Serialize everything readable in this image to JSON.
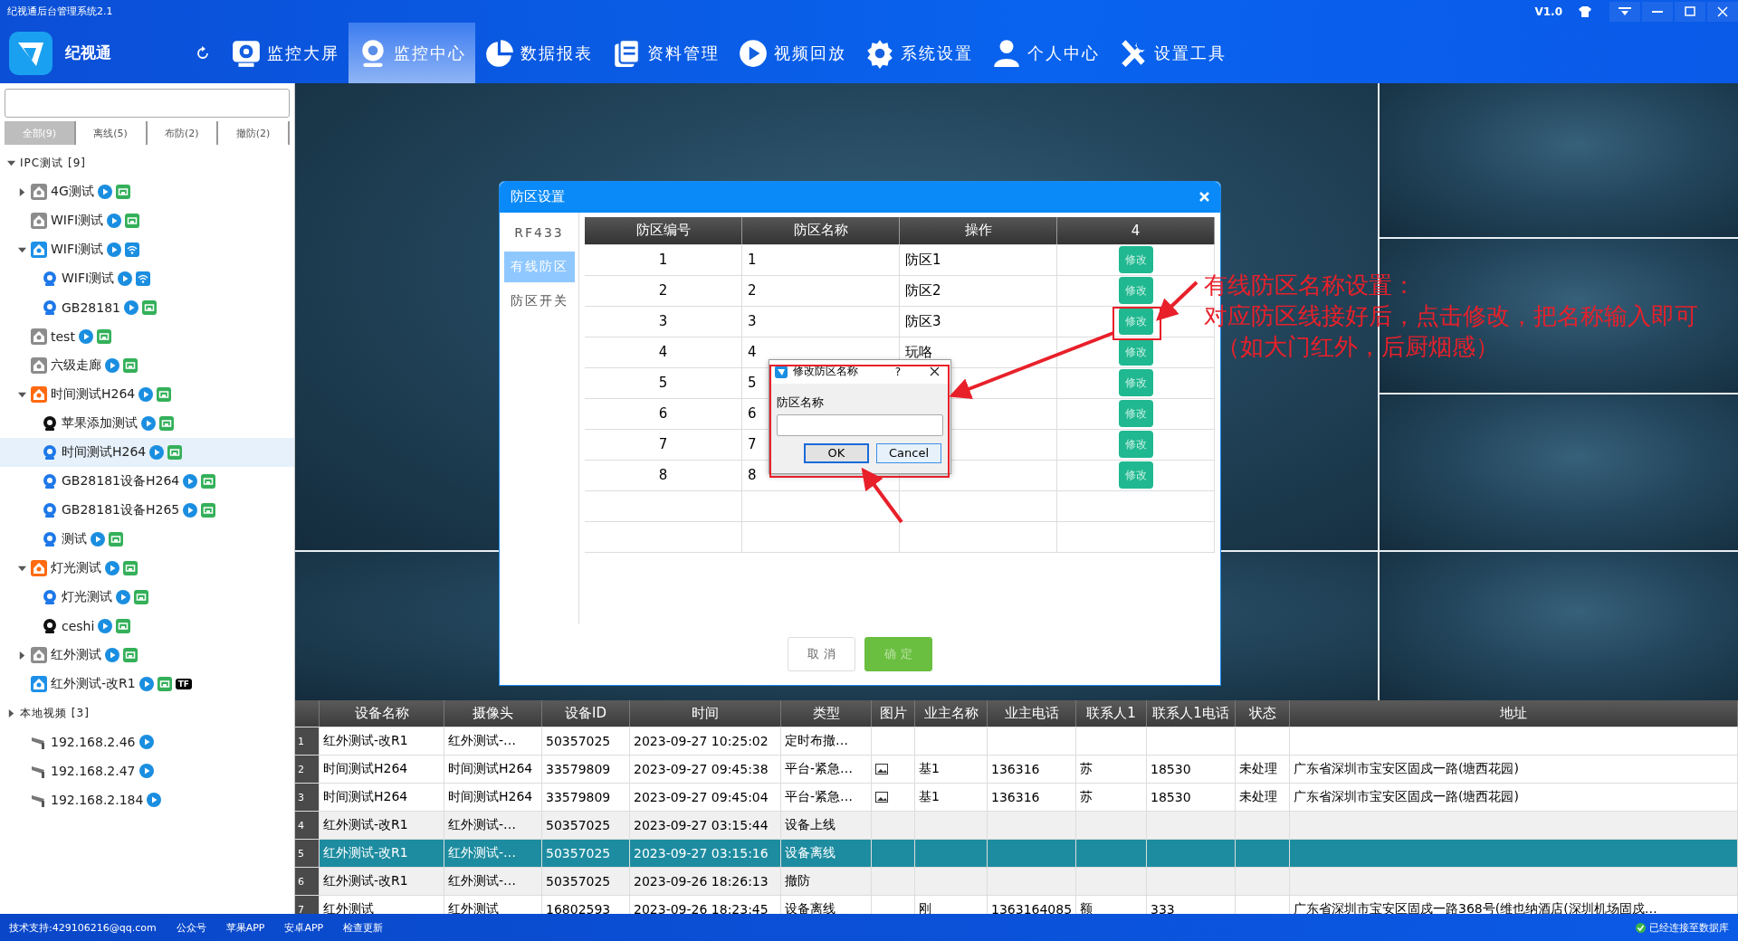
{
  "window": {
    "title": "纪视通后台管理系统2.1",
    "version": "V1.0"
  },
  "header": {
    "logo_text": "纪视通",
    "nav": [
      {
        "label": "监控大屏",
        "selected": false
      },
      {
        "label": "监控中心",
        "selected": true
      },
      {
        "label": "数据报表",
        "selected": false
      },
      {
        "label": "资料管理",
        "selected": false
      },
      {
        "label": "视频回放",
        "selected": false
      },
      {
        "label": "系统设置",
        "selected": false
      },
      {
        "label": "个人中心",
        "selected": false
      },
      {
        "label": "设置工具",
        "selected": false
      }
    ]
  },
  "sidebar": {
    "filters": [
      {
        "label": "全部(9)",
        "selected": true
      },
      {
        "label": "离线(5)",
        "selected": false
      },
      {
        "label": "布防(2)",
        "selected": false
      },
      {
        "label": "撤防(2)",
        "selected": false
      }
    ],
    "tree": [
      {
        "label": "IPC测试 [9]",
        "kind": "folder",
        "expanded": true,
        "selected": false,
        "children": [
          {
            "label": "4G测试",
            "kind": "group",
            "color": "#8c8c8c",
            "expanded": false,
            "selected": false,
            "badges": [
              {
                "kind": "play"
              },
              {
                "kind": "wired"
              }
            ]
          },
          {
            "label": "WIFI测试",
            "kind": "group",
            "color": "#8c8c8c",
            "selected": false,
            "badges": [
              {
                "kind": "play"
              },
              {
                "kind": "wired"
              }
            ]
          },
          {
            "label": "WIFI测试",
            "kind": "group",
            "color": "#1e90e8",
            "expanded": true,
            "selected": false,
            "badges": [
              {
                "kind": "play"
              },
              {
                "kind": "wifi"
              }
            ],
            "children": [
              {
                "label": "WIFI测试",
                "kind": "camera",
                "color": "#1e78e8",
                "selected": false,
                "badges": [
                  {
                    "kind": "play"
                  },
                  {
                    "kind": "wifi"
                  }
                ]
              },
              {
                "label": "GB28181",
                "kind": "camera",
                "color": "#1e78e8",
                "selected": false,
                "badges": [
                  {
                    "kind": "play"
                  },
                  {
                    "kind": "wired"
                  }
                ]
              }
            ]
          },
          {
            "label": "test",
            "kind": "group",
            "color": "#8c8c8c",
            "selected": false,
            "badges": [
              {
                "kind": "play"
              },
              {
                "kind": "wired"
              }
            ]
          },
          {
            "label": "六级走廊",
            "kind": "group",
            "color": "#8c8c8c",
            "selected": false,
            "badges": [
              {
                "kind": "play"
              },
              {
                "kind": "wired"
              }
            ]
          },
          {
            "label": "时间测试H264",
            "kind": "group",
            "color": "#ff6a10",
            "expanded": true,
            "selected": false,
            "badges": [
              {
                "kind": "play"
              },
              {
                "kind": "wired"
              }
            ],
            "children": [
              {
                "label": "苹果添加测试",
                "kind": "camera",
                "color": "#111111",
                "selected": false,
                "badges": [
                  {
                    "kind": "play"
                  },
                  {
                    "kind": "wired"
                  }
                ]
              },
              {
                "label": "时间测试H264",
                "kind": "camera",
                "color": "#1e78e8",
                "selected": true,
                "badges": [
                  {
                    "kind": "play"
                  },
                  {
                    "kind": "wired"
                  }
                ]
              },
              {
                "label": "GB28181设备H264",
                "kind": "camera",
                "color": "#1e78e8",
                "selected": false,
                "badges": [
                  {
                    "kind": "play"
                  },
                  {
                    "kind": "wired"
                  }
                ]
              },
              {
                "label": "GB28181设备H265",
                "kind": "camera",
                "color": "#1e78e8",
                "selected": false,
                "badges": [
                  {
                    "kind": "play"
                  },
                  {
                    "kind": "wired"
                  }
                ]
              },
              {
                "label": "测试",
                "kind": "camera",
                "color": "#1e78e8",
                "selected": false,
                "badges": [
                  {
                    "kind": "play"
                  },
                  {
                    "kind": "wired"
                  }
                ]
              }
            ]
          },
          {
            "label": "灯光测试",
            "kind": "group",
            "color": "#ff6a10",
            "expanded": true,
            "selected": false,
            "badges": [
              {
                "kind": "play"
              },
              {
                "kind": "wired"
              }
            ],
            "children": [
              {
                "label": "灯光测试",
                "kind": "camera",
                "color": "#1e78e8",
                "selected": false,
                "badges": [
                  {
                    "kind": "play"
                  },
                  {
                    "kind": "wired"
                  }
                ]
              },
              {
                "label": "ceshi",
                "kind": "camera",
                "color": "#111111",
                "selected": false,
                "badges": [
                  {
                    "kind": "play"
                  },
                  {
                    "kind": "wired"
                  }
                ]
              }
            ]
          },
          {
            "label": "红外测试",
            "kind": "group",
            "color": "#8c8c8c",
            "expanded": false,
            "selected": false,
            "badges": [
              {
                "kind": "play"
              },
              {
                "kind": "wired"
              }
            ]
          },
          {
            "label": "红外测试-改R1",
            "kind": "group",
            "color": "#1e90e8",
            "selected": false,
            "badges": [
              {
                "kind": "play"
              },
              {
                "kind": "wired"
              },
              {
                "kind": "tag",
                "text": "TF"
              }
            ]
          }
        ]
      },
      {
        "label": "本地视频 [3]",
        "kind": "folder",
        "expanded": false,
        "selected": false,
        "children": [
          {
            "label": "192.168.2.46",
            "kind": "cctv",
            "selected": false,
            "badges": [
              {
                "kind": "play"
              }
            ]
          },
          {
            "label": "192.168.2.47",
            "kind": "cctv",
            "selected": false,
            "badges": [
              {
                "kind": "play"
              }
            ]
          },
          {
            "label": "192.168.2.184",
            "kind": "cctv",
            "selected": false,
            "badges": [
              {
                "kind": "play"
              }
            ]
          }
        ]
      }
    ]
  },
  "zone_dialog": {
    "title": "防区设置",
    "nav": [
      {
        "label": "RF433",
        "selected": false
      },
      {
        "label": "有线防区",
        "selected": true
      },
      {
        "label": "防区开关",
        "selected": false
      }
    ],
    "columns": [
      "防区编号",
      "防区名称",
      "操作",
      "4"
    ],
    "rows": [
      {
        "no": "1",
        "id": "1",
        "name": "防区1",
        "button": "修改"
      },
      {
        "no": "2",
        "id": "2",
        "name": "防区2",
        "button": "修改"
      },
      {
        "no": "3",
        "id": "3",
        "name": "防区3",
        "button": "修改"
      },
      {
        "no": "4",
        "id": "4",
        "name": "玩咯",
        "button": "修改"
      },
      {
        "no": "5",
        "id": "5",
        "button": "修改"
      },
      {
        "no": "6",
        "id": "6",
        "button": "修改"
      },
      {
        "no": "7",
        "id": "7",
        "button": "修改"
      },
      {
        "no": "8",
        "id": "8",
        "button": "修改"
      }
    ],
    "buttons": [
      {
        "label": "取 消",
        "kind": "cancel"
      },
      {
        "label": "确 定",
        "kind": "confirm"
      }
    ]
  },
  "rename_popup": {
    "title": "修改防区名称",
    "help": "?",
    "label": "防区名称",
    "buttons": [
      "OK",
      "Cancel"
    ]
  },
  "annotation": {
    "lines": [
      "有线防区名称设置：",
      "对应防区线接好后，点击修改，把名称输入即可",
      "（如大门红外，后厨烟感）"
    ]
  },
  "event_table": {
    "columns": [
      "设备名称",
      "摄像头",
      "设备ID",
      "时间",
      "类型",
      "图片",
      "业主名称",
      "业主电话",
      "联系人1",
      "联系人1电话",
      "状态",
      "地址"
    ],
    "rows": [
      {
        "no": "1",
        "selected": false,
        "image": false,
        "cells": [
          "红外测试-改R1",
          "红外测试-…",
          "50357025",
          "2023-09-27 10:25:02",
          "定时布撤…",
          null,
          null,
          null,
          null,
          null,
          null,
          null
        ]
      },
      {
        "no": "2",
        "selected": false,
        "image": true,
        "cells": [
          "时间测试H264",
          "时间测试H264",
          "33579809",
          "2023-09-27 09:45:38",
          "平台-紧急…",
          null,
          "基1",
          "136316",
          "苏",
          "18530",
          "未处理",
          "广东省深圳市宝安区固戍一路(塘西花园)"
        ]
      },
      {
        "no": "3",
        "selected": false,
        "image": true,
        "cells": [
          "时间测试H264",
          "时间测试H264",
          "33579809",
          "2023-09-27 09:45:04",
          "平台-紧急…",
          null,
          "基1",
          "136316",
          "苏",
          "18530",
          "未处理",
          "广东省深圳市宝安区固戍一路(塘西花园)"
        ]
      },
      {
        "no": "4",
        "selected": false,
        "image": false,
        "cells": [
          "红外测试-改R1",
          "红外测试-…",
          "50357025",
          "2023-09-27 03:15:44",
          "设备上线",
          null,
          null,
          null,
          null,
          null,
          null,
          null
        ]
      },
      {
        "no": "5",
        "selected": true,
        "image": false,
        "cells": [
          "红外测试-改R1",
          "红外测试-…",
          "50357025",
          "2023-09-27 03:15:16",
          "设备离线",
          null,
          null,
          null,
          null,
          null,
          null,
          null
        ]
      },
      {
        "no": "6",
        "selected": false,
        "image": false,
        "cells": [
          "红外测试-改R1",
          "红外测试-…",
          "50357025",
          "2023-09-26 18:26:13",
          "撤防",
          null,
          null,
          null,
          null,
          null,
          null,
          null
        ]
      },
      {
        "no": "7",
        "selected": false,
        "image": false,
        "cells": [
          "红外测试",
          "红外测试",
          "16802593",
          "2023-09-26 18:23:45",
          "设备离线",
          null,
          "刚",
          "1363164085",
          "额",
          "333",
          null,
          "广东省深圳市宝安区固戍一路368号(维也纳酒店(深圳机场固戍…"
        ]
      }
    ]
  },
  "status_bar": {
    "links": [
      "技术支持:429106216@qq.com",
      "公众号",
      "苹果APP",
      "安卓APP",
      "检查更新"
    ],
    "connection": "已经连接至数据库"
  }
}
